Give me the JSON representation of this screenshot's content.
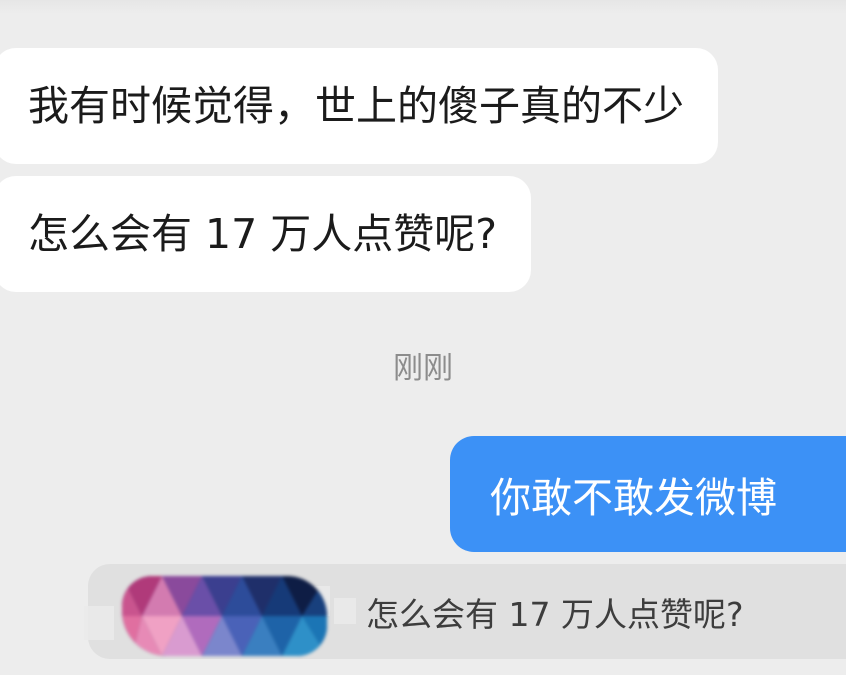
{
  "messages": [
    {
      "side": "incoming",
      "text": "我有时候觉得，世上的傻子真的不少"
    },
    {
      "side": "incoming",
      "text": "怎么会有 17 万人点赞呢?"
    }
  ],
  "timestamp": "刚刚",
  "reply": {
    "side": "outgoing",
    "text": "你敢不敢发微博"
  },
  "quoted": {
    "text": "怎么会有 17 万人点赞呢?"
  },
  "colors": {
    "background": "#ededed",
    "incoming_bubble": "#ffffff",
    "outgoing_bubble": "#3c91f6",
    "quote_bg": "#e0e0e0",
    "timestamp": "#8c8c8c"
  }
}
